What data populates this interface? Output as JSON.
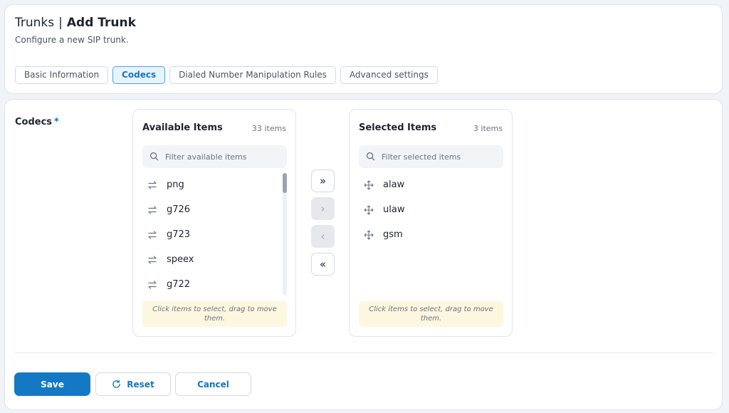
{
  "header": {
    "breadcrumb": "Trunks",
    "separator": "|",
    "title": "Add Trunk",
    "subtitle": "Configure a new SIP trunk."
  },
  "tabs": [
    {
      "label": "Basic Information",
      "active": false
    },
    {
      "label": "Codecs",
      "active": true
    },
    {
      "label": "Dialed Number Manipulation Rules",
      "active": false
    },
    {
      "label": "Advanced settings",
      "active": false
    }
  ],
  "form": {
    "field_label": "Codecs",
    "required_mark": "*"
  },
  "available": {
    "title": "Available Items",
    "count": "33 items",
    "filter_placeholder": "Filter available items",
    "items": [
      "png",
      "g726",
      "g723",
      "speex",
      "g722"
    ],
    "hint": "Click items to select, drag to move them.",
    "scroll_position": 0
  },
  "selected": {
    "title": "Selected Items",
    "count": "3 items",
    "filter_placeholder": "Filter selected items",
    "items": [
      "alaw",
      "ulaw",
      "gsm"
    ],
    "hint": "Click items to select, drag to move them."
  },
  "transfer": {
    "move_all_right": "»",
    "move_right": "›",
    "move_left": "‹",
    "move_all_left": "«"
  },
  "footer": {
    "save_label": "Save",
    "reset_label": "Reset",
    "cancel_label": "Cancel"
  },
  "icons": {
    "search": "search-icon",
    "swap": "swap-arrows-icon",
    "drag": "move-arrows-icon",
    "reset": "refresh-icon"
  },
  "colors": {
    "primary": "#1479c4",
    "active_tab_bg": "#e8f4fc",
    "hint_bg": "#fdf7df"
  }
}
